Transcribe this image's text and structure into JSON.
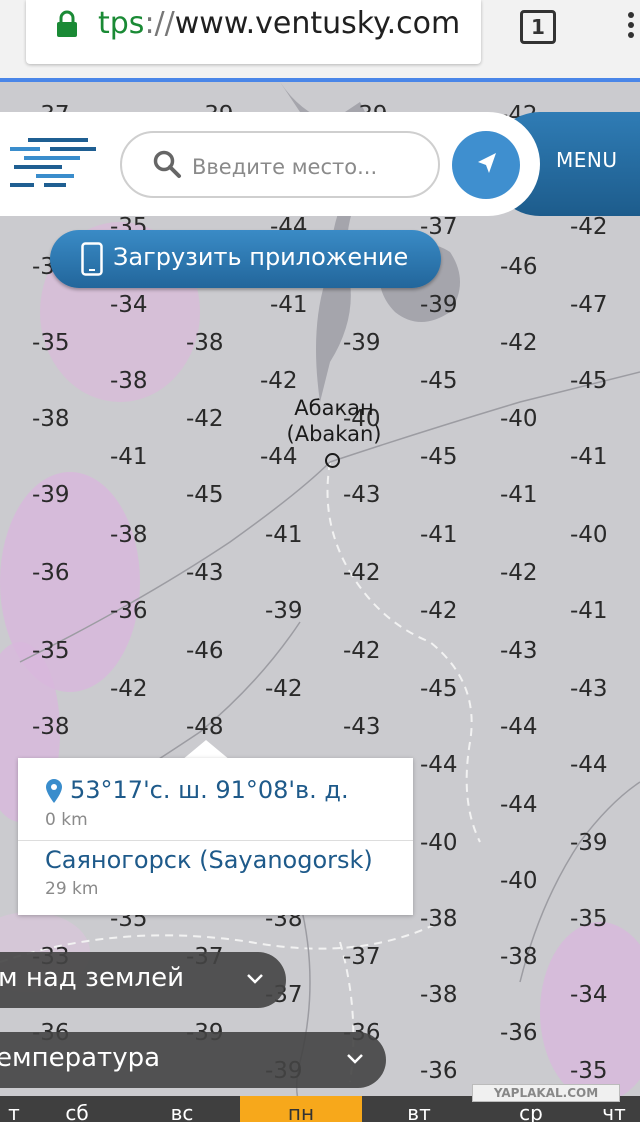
{
  "browser": {
    "url_scheme": "tps",
    "url_sep": "://",
    "url_host": "www.ventusky.com",
    "tab_count": "1"
  },
  "header": {
    "search_placeholder": "Введите место...",
    "menu_label": "MENU",
    "app_button_label": "Загрузить приложение"
  },
  "map": {
    "city_name_local": "Абакан",
    "city_name_latin": "(Abakan)",
    "temperatures": [
      {
        "v": "-37",
        "cls": "partial"
      },
      {
        "v": "-39"
      },
      {
        "v": "-39"
      },
      {
        "v": "-42"
      },
      {
        "v": "-35"
      },
      {
        "v": "-44"
      },
      {
        "v": "-37"
      },
      {
        "v": "-42"
      },
      {
        "v": "-3"
      },
      {
        "v": "-46"
      },
      {
        "v": "-34"
      },
      {
        "v": "-41"
      },
      {
        "v": "-39"
      },
      {
        "v": "-47"
      },
      {
        "v": "-35"
      },
      {
        "v": "-38"
      },
      {
        "v": "-39"
      },
      {
        "v": "-42"
      },
      {
        "v": "-38"
      },
      {
        "v": "-42"
      },
      {
        "v": "-45"
      },
      {
        "v": "-45"
      },
      {
        "v": "-38"
      },
      {
        "v": "-42"
      },
      {
        "v": "-40"
      },
      {
        "v": "-40"
      },
      {
        "v": "-41"
      },
      {
        "v": "-44"
      },
      {
        "v": "-45"
      },
      {
        "v": "-41"
      },
      {
        "v": "-39"
      },
      {
        "v": "-45"
      },
      {
        "v": "-43"
      },
      {
        "v": "-41"
      },
      {
        "v": "-38"
      },
      {
        "v": "-41"
      },
      {
        "v": "-41"
      },
      {
        "v": "-40"
      },
      {
        "v": "-36"
      },
      {
        "v": "-43"
      },
      {
        "v": "-42"
      },
      {
        "v": "-42"
      },
      {
        "v": "-36"
      },
      {
        "v": "-39"
      },
      {
        "v": "-42"
      },
      {
        "v": "-41"
      },
      {
        "v": "-35"
      },
      {
        "v": "-46"
      },
      {
        "v": "-42"
      },
      {
        "v": "-43"
      },
      {
        "v": "-42"
      },
      {
        "v": "-42"
      },
      {
        "v": "-45"
      },
      {
        "v": "-43"
      },
      {
        "v": "-38"
      },
      {
        "v": "-48"
      },
      {
        "v": "-43"
      },
      {
        "v": "-44"
      },
      {
        "v": "-44"
      },
      {
        "v": "-44"
      },
      {
        "v": "-44"
      },
      {
        "v": "-40"
      },
      {
        "v": "-39"
      },
      {
        "v": "-40"
      },
      {
        "v": "-35"
      },
      {
        "v": "-38"
      },
      {
        "v": "-38"
      },
      {
        "v": "-35"
      },
      {
        "v": "-33"
      },
      {
        "v": "-37"
      },
      {
        "v": "-37"
      },
      {
        "v": "-38"
      },
      {
        "v": "-37"
      },
      {
        "v": "-38"
      },
      {
        "v": "-34"
      },
      {
        "v": "-36"
      },
      {
        "v": "-39"
      },
      {
        "v": "-36"
      },
      {
        "v": "-36"
      },
      {
        "v": "-39"
      },
      {
        "v": "-36"
      },
      {
        "v": "-35"
      }
    ]
  },
  "popup": {
    "coordinates": "53°17'с. ш. 91°08'в. д.",
    "coord_distance": "0 km",
    "nearest_place": "Саяногорск (Sayanogorsk)",
    "place_distance": "29 km"
  },
  "controls": {
    "altitude_label": "м над землей",
    "layer_label": "емпература"
  },
  "days": [
    {
      "label": "т"
    },
    {
      "label": "сб"
    },
    {
      "label": "вс"
    },
    {
      "label": "пн"
    },
    {
      "label": "вт"
    },
    {
      "label": "ср"
    },
    {
      "label": "чт"
    }
  ],
  "watermark": "YAPLAKAL.COM",
  "colors": {
    "accent": "#3f8fcf",
    "menu": "#1d5c8c",
    "active_day": "#f7a81b",
    "lock": "#1a8a35"
  }
}
